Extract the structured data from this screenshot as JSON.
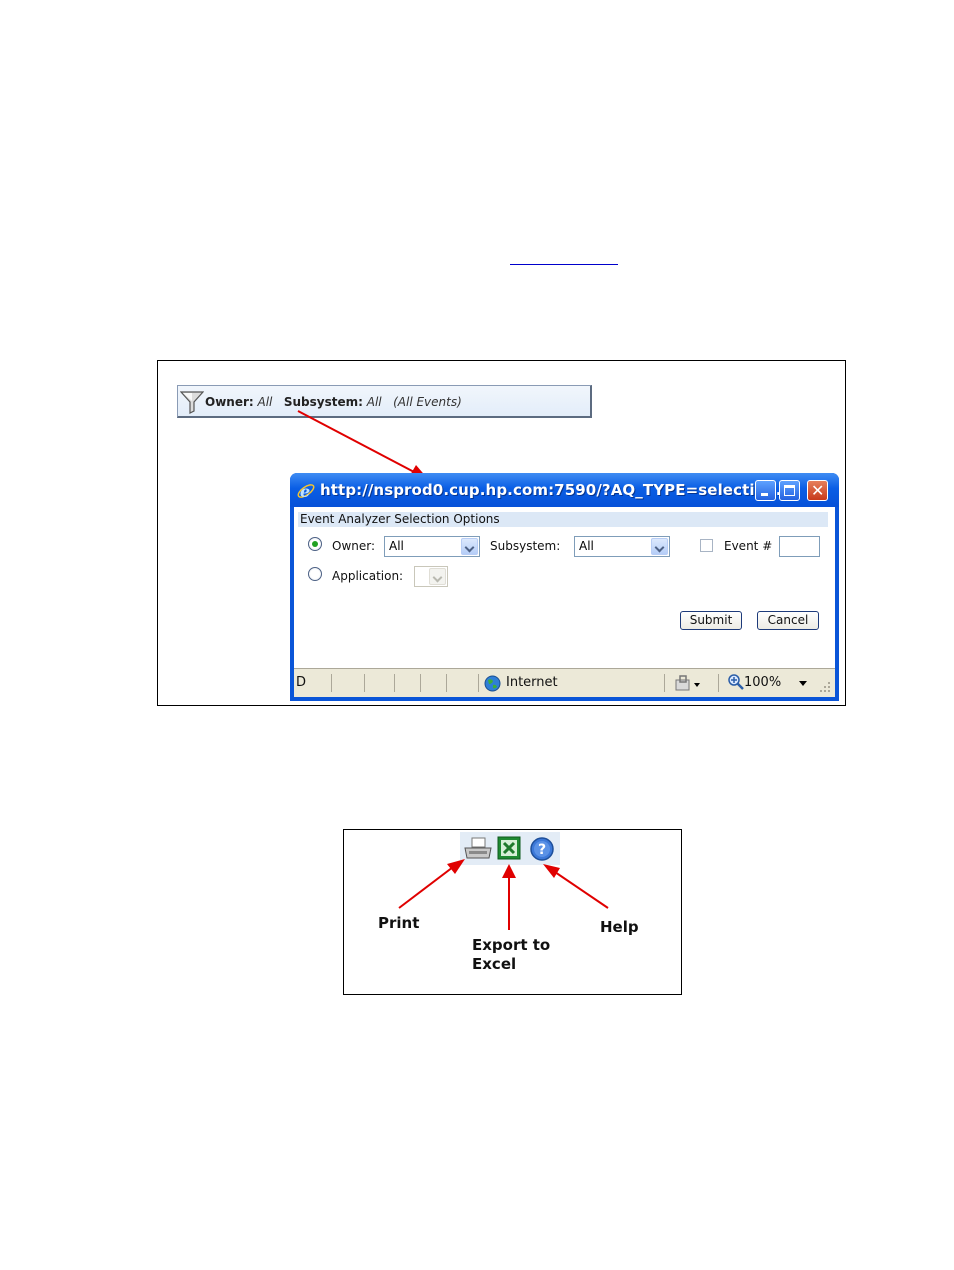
{
  "figure1": {
    "filter_bar": {
      "owner_label": "Owner:",
      "owner_value": "All",
      "subsystem_label": "Subsystem:",
      "subsystem_value": "All",
      "events_note": "(All Events)"
    },
    "popup": {
      "title": "http://nsprod0.cup.hp.com:7590/?AQ_TYPE=selection...",
      "header": "Event Analyzer Selection Options",
      "owner_label": "Owner:",
      "owner_value": "All",
      "subsystem_label": "Subsystem:",
      "subsystem_value": "All",
      "event_label": "Event #",
      "event_value": "",
      "application_label": "Application:",
      "application_value": "",
      "selected_option": "Owner",
      "submit_label": "Submit",
      "cancel_label": "Cancel",
      "status": {
        "left_text": "D",
        "zone": "Internet",
        "zoom": "100%"
      }
    }
  },
  "figure2": {
    "icons": [
      "print-icon",
      "excel-icon",
      "help-icon"
    ],
    "callouts": {
      "print": "Print",
      "export_line1": "Export to",
      "export_line2": "Excel",
      "help": "Help"
    }
  },
  "colors": {
    "arrow": "#e00000",
    "titlebar": "#0a5ee5",
    "header_strip": "#dce8f6"
  }
}
